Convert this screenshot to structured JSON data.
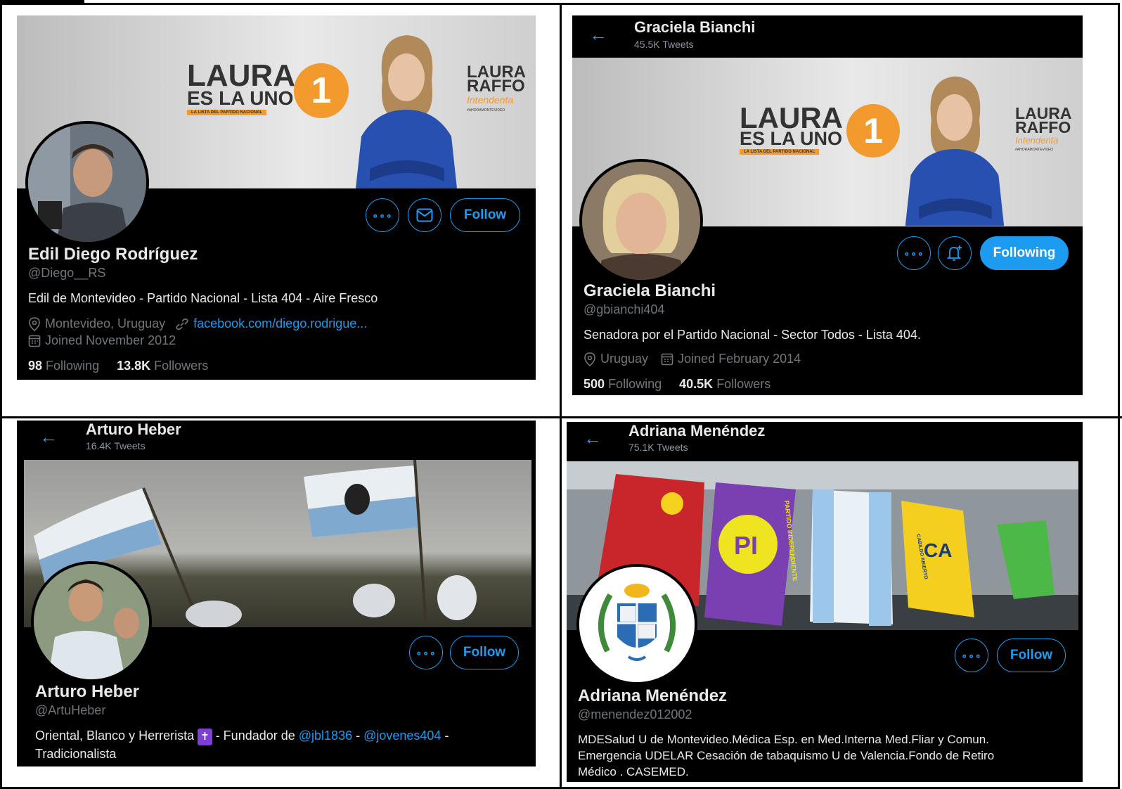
{
  "colors": {
    "accent": "#1d9bf0",
    "laura_orange": "#f29a2e",
    "bg": "#000000"
  },
  "icons": [
    "more-icon",
    "mail-icon",
    "bell-plus-icon",
    "location-icon",
    "link-icon",
    "calendar-icon",
    "back-arrow-icon"
  ],
  "p1": {
    "banner": {
      "line1": "LAURA",
      "line2": "ES LA UNO",
      "tag": "LA LISTA DEL PARTIDO NACIONAL",
      "number": "1",
      "brand1": "LAURA",
      "brand2": "RAFFO",
      "brand3": "Intendenta",
      "brand4": "#AHORAMONTEVIDEO"
    },
    "follow": "Follow",
    "name": "Edil Diego Rodríguez",
    "handle": "@Diego__RS",
    "bio": "Edil de Montevideo - Partido Nacional - Lista 404 - Aire Fresco",
    "location": "Montevideo, Uruguay",
    "link": "facebook.com/diego.rodrigue...",
    "joined": "Joined November 2012",
    "following_n": "98",
    "following_l": "Following",
    "followers_n": "13.8K",
    "followers_l": "Followers"
  },
  "p2": {
    "header_name": "Graciela Bianchi",
    "tweets": "45.5K Tweets",
    "banner": {
      "line1": "LAURA",
      "line2": "ES LA UNO",
      "tag": "LA LISTA DEL PARTIDO NACIONAL",
      "number": "1",
      "brand1": "LAURA",
      "brand2": "RAFFO",
      "brand3": "Intendenta",
      "brand4": "#AHORAMONTEVIDEO"
    },
    "following_btn": "Following",
    "name": "Graciela Bianchi",
    "handle": "@gbianchi404",
    "bio": "Senadora por el Partido Nacional - Sector Todos - Lista 404.",
    "location": "Uruguay",
    "joined": "Joined February 2014",
    "following_n": "500",
    "following_l": "Following",
    "followers_n": "40.5K",
    "followers_l": "Followers"
  },
  "p3": {
    "header_name": "Arturo Heber",
    "tweets": "16.4K Tweets",
    "follow": "Follow",
    "name": "Arturo Heber",
    "handle": "@ArtuHeber",
    "bio_a": "Oriental, Blanco y Herrerista",
    "bio_cross": "✝",
    "bio_b": " - Fundador de ",
    "bio_m1": "@jbl1836",
    "bio_c": " - ",
    "bio_m2": "@jovenes404",
    "bio_d": " -",
    "bio_e": "Tradicionalista"
  },
  "p4": {
    "header_name": "Adriana Menéndez",
    "tweets": "75.1K Tweets",
    "flags": {
      "pi": "PI",
      "pi_text": "PARTIDO INDEPENDIENTE",
      "ca": "CA",
      "ca_text": "CABILDO ABIERTO"
    },
    "follow": "Follow",
    "name": "Adriana Menéndez",
    "handle": "@menendez012002",
    "bio1": "MDESalud U de Montevideo.Médica Esp. en Med.Interna Med.Fliar y Comun.",
    "bio2": "Emergencia UDELAR Cesación de tabaquismo U de Valencia.Fondo de Retiro",
    "bio3": "Médico . CASEMED."
  }
}
